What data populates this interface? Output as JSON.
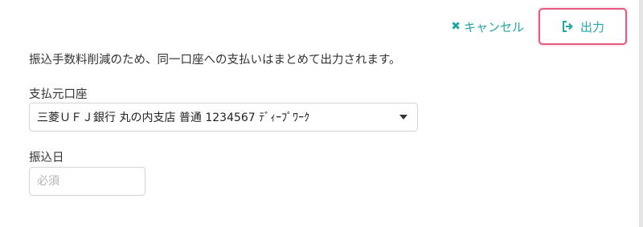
{
  "colors": {
    "accent": "#22a7a0",
    "highlight": "#e55a80",
    "border": "#d4d4d4",
    "placeholder": "#b3b3b3"
  },
  "toolbar": {
    "cancel_label": "キャンセル",
    "cancel_icon": "close-icon",
    "export_label": "出力",
    "export_icon": "export-icon"
  },
  "info": {
    "text": "振込手数料削減のため、同一口座への支払いはまとめて出力されます。"
  },
  "form": {
    "account": {
      "label": "支払元口座",
      "selected": "三菱ＵＦＪ銀行 丸の内支店 普通 1234567 ﾃﾞｨｰﾌﾟﾜｰｸ"
    },
    "date": {
      "label": "振込日",
      "placeholder": "必須",
      "value": ""
    }
  }
}
